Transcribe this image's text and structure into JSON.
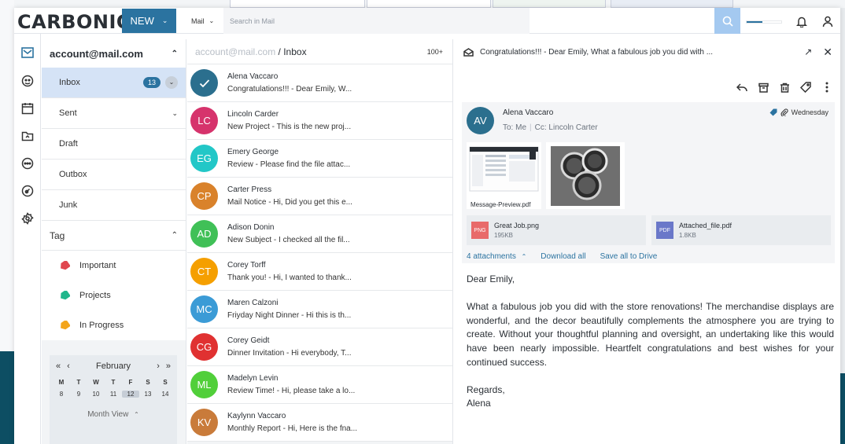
{
  "brand": {
    "logo": "CARBONIO",
    "accent": "#2b73a0"
  },
  "header": {
    "new_label": "NEW",
    "module": "Mail",
    "search_placeholder": "Search in Mail",
    "quota_fraction": 0.45
  },
  "folders": {
    "account": "account@mail.com",
    "items": [
      {
        "label": "Inbox",
        "badge": "13"
      },
      {
        "label": "Sent"
      },
      {
        "label": "Draft"
      },
      {
        "label": "Outbox"
      },
      {
        "label": "Junk"
      }
    ],
    "tag_title": "Tag",
    "tags": [
      {
        "label": "Important",
        "color": "#e0464f"
      },
      {
        "label": "Projects",
        "color": "#1fb68b"
      },
      {
        "label": "In Progress",
        "color": "#f3a51b"
      }
    ]
  },
  "calendar": {
    "month": "February",
    "weekdays": [
      "M",
      "T",
      "W",
      "T",
      "F",
      "S",
      "S"
    ],
    "dates": [
      "8",
      "9",
      "10",
      "11",
      "12",
      "13",
      "14"
    ],
    "today": "12",
    "view_label": "Month View"
  },
  "list": {
    "path_account": "account@mail.com",
    "path_folder": " / Inbox",
    "count": "100+",
    "messages": [
      {
        "initials": "",
        "color": "#2b6f8e",
        "sender": "Alena Vaccaro",
        "subject": "Congratulations!!! - ",
        "preview": "Dear Emily, W..."
      },
      {
        "initials": "LC",
        "color": "#d6336c",
        "sender": "Lincoln Carder",
        "subject": "New Project - ",
        "preview": "This is the new proj..."
      },
      {
        "initials": "EG",
        "color": "#22c7c7",
        "sender": "Emery George",
        "subject": "Review - ",
        "preview": "Please find the file attac..."
      },
      {
        "initials": "CP",
        "color": "#d9822b",
        "sender": "Carter Press",
        "subject": "Mail Notice - ",
        "preview": "Hi, Did you get this e..."
      },
      {
        "initials": "AD",
        "color": "#40c057",
        "sender": "Adison Donin",
        "subject": "New Subject - ",
        "preview": "I checked all the fil..."
      },
      {
        "initials": "CT",
        "color": "#f59f00",
        "sender": "Corey Torff",
        "subject": "Thank you! - ",
        "preview": "Hi, I wanted to thank..."
      },
      {
        "initials": "MC",
        "color": "#3b9bd6",
        "sender": "Maren Calzoni",
        "subject": "Friyday Night Dinner - ",
        "preview": "Hi this is th..."
      },
      {
        "initials": "CG",
        "color": "#e03131",
        "sender": "Corey Geidt",
        "subject": "Dinner Invitation - ",
        "preview": "Hi everybody, T..."
      },
      {
        "initials": "ML",
        "color": "#51cf3a",
        "sender": "Madelyn Levin",
        "subject": "Review Time! - ",
        "preview": "Hi, please take a lo..."
      },
      {
        "initials": "KV",
        "color": "#c97b3a",
        "sender": "Kaylynn Vaccaro",
        "subject": "Monthly Report - ",
        "preview": "Hi, Here is the fna..."
      }
    ]
  },
  "reader": {
    "subject": "Congratulations!!! - Dear Emily, What a fabulous job you did with ...",
    "from_initials": "AV",
    "from_name": "Alena Vaccaro",
    "to_label": "To:",
    "to_value": "Me",
    "cc_label": "Cc:",
    "cc_value": "Lincoln Carter",
    "date": "Wednesday",
    "preview_label": "Message-Preview.pdf",
    "files": [
      {
        "ext": "PNG",
        "color": "#e86a6a",
        "name": "Great Job.png",
        "size": "195KB"
      },
      {
        "ext": "PDF",
        "color": "#6a78c9",
        "name": "Attached_file.pdf",
        "size": "1.8KB"
      }
    ],
    "attachments_label": "4 attachments",
    "download_all": "Download all",
    "save_drive": "Save all to Drive",
    "greeting": "Dear Emily,",
    "body": "What a fabulous job you did with the store renovations! The merchandise displays are wonderful, and the decor beautifully complements the atmosphere you are trying to create. Without your thoughtful planning and oversight, an undertaking like this would have been nearly impossible. Heartfelt congratulations and best wishes for your continued success.",
    "signoff": "Regards,",
    "signature": "Alena"
  }
}
